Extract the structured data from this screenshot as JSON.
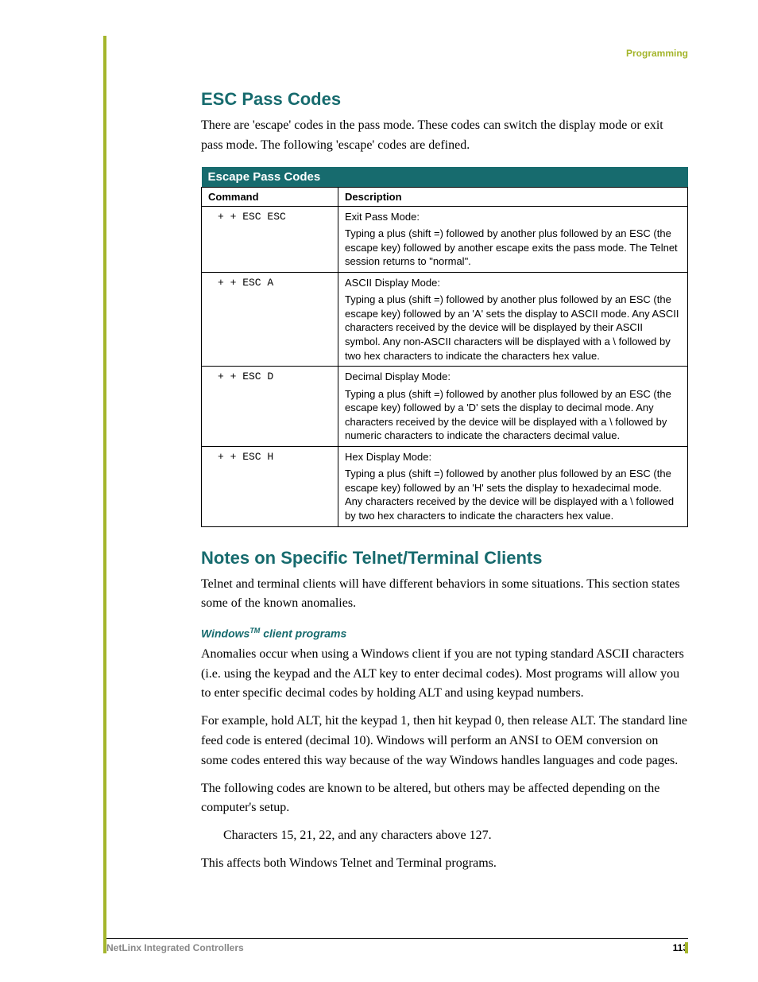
{
  "header": {
    "section_label": "Programming"
  },
  "section1": {
    "heading": "ESC Pass Codes",
    "intro": "There are 'escape' codes in the pass mode. These codes can switch the display mode or exit pass mode. The following 'escape' codes are defined."
  },
  "table": {
    "title": "Escape Pass Codes",
    "col_command": "Command",
    "col_description": "Description",
    "rows": [
      {
        "command": "+ + ESC ESC",
        "head": "Exit Pass Mode:",
        "body": "Typing a plus (shift =) followed by another plus followed by an ESC (the escape key) followed by another escape exits the pass mode. The Telnet session returns to \"normal\"."
      },
      {
        "command": "+ + ESC A",
        "head": "ASCII Display Mode:",
        "body": "Typing a plus (shift =) followed by another plus followed by an ESC (the escape key) followed by an 'A' sets the display to ASCII mode. Any ASCII characters received by the device will be displayed by their ASCII symbol. Any non-ASCII characters will be displayed with a \\ followed by two hex characters to indicate the characters hex value."
      },
      {
        "command": "+ + ESC D",
        "head": "Decimal Display Mode:",
        "body": "Typing a plus (shift =) followed by another plus followed by an ESC (the escape key) followed by a 'D' sets the display to decimal mode. Any characters received by the device will be displayed with a \\ followed by numeric characters to indicate the characters decimal value."
      },
      {
        "command": "+ + ESC H",
        "head": "Hex Display Mode:",
        "body": "Typing a plus (shift =) followed by another plus followed by an ESC (the escape key) followed by an 'H' sets the display to hexadecimal mode. Any characters received by the device will be displayed with a \\ followed by two hex characters to indicate the characters hex value."
      }
    ]
  },
  "section2": {
    "heading": "Notes on Specific Telnet/Terminal Clients",
    "intro": "Telnet and terminal clients will have different behaviors in some situations. This section states some of the known anomalies.",
    "sub_heading_prefix": "Windows",
    "sub_heading_tm": "TM",
    "sub_heading_suffix": " client programs",
    "p1": "Anomalies occur when using a Windows client if you are not typing standard ASCII characters (i.e. using the keypad and the ALT key to enter decimal codes). Most programs will allow you to enter specific decimal codes by holding ALT and using keypad numbers.",
    "p2": "For example, hold ALT, hit the keypad 1, then hit keypad 0, then release ALT. The standard line feed code is entered (decimal 10). Windows will perform an ANSI to OEM conversion on some codes entered this way because of the way Windows handles languages and code pages.",
    "p3": "The following codes are known to be altered, but others may be affected depending on the computer's setup.",
    "p4": "Characters 15, 21, 22, and any characters above 127.",
    "p5": "This affects both Windows Telnet and Terminal programs."
  },
  "footer": {
    "doc_title": "NetLinx Integrated Controllers",
    "page_number": "113"
  }
}
